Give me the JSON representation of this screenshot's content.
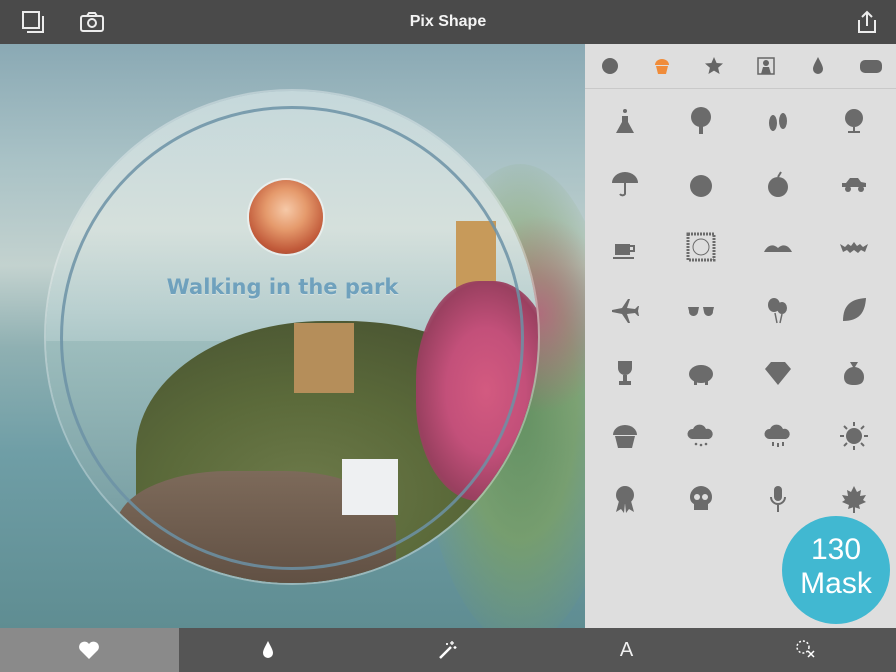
{
  "app": {
    "title": "Pix Shape"
  },
  "toolbar": {
    "left_icons": [
      "layers-icon",
      "camera-icon"
    ],
    "right_icon": "share-icon"
  },
  "canvas": {
    "caption": "Walking in the park"
  },
  "shape_tabs": [
    "circle-icon",
    "cupcake-icon",
    "star-icon",
    "silhouette-icon",
    "drop-icon",
    "cloud-shape-icon"
  ],
  "active_shape_tab": "cupcake-icon",
  "shape_grid": [
    [
      "flask-icon",
      "tree-icon",
      "footprints-icon",
      "globe-icon"
    ],
    [
      "umbrella-icon",
      "tomato-icon",
      "apple-icon",
      "car-icon"
    ],
    [
      "coffee-cup-icon",
      "lace-frame-icon",
      "mustache-icon",
      "bat-icon"
    ],
    [
      "airplane-icon",
      "sunglasses-icon",
      "balloons-icon",
      "leaf-icon"
    ],
    [
      "trophy-icon",
      "piggy-bank-icon",
      "diamond-icon",
      "money-bag-icon"
    ],
    [
      "cupcake-icon",
      "snow-cloud-icon",
      "rain-cloud-icon",
      "sun-icon"
    ],
    [
      "award-ribbon-icon",
      "skull-icon",
      "microphone-icon",
      "maple-leaf-icon"
    ]
  ],
  "mask_badge": {
    "count": "130",
    "label": "Mask"
  },
  "bottom_tabs": [
    {
      "icon": "heart-icon",
      "text": ""
    },
    {
      "icon": "drop-icon",
      "text": ""
    },
    {
      "icon": "magic-wand-icon",
      "text": ""
    },
    {
      "icon": "text-icon",
      "text": "A"
    },
    {
      "icon": "scissors-icon",
      "text": ""
    }
  ],
  "colors": {
    "top_bar": "#4a4a4a",
    "bottom_bar": "#555555",
    "active_tab_bg": "#8a8a8a",
    "icon_gray": "#6b6b6b",
    "accent_orange": "#f08c3a",
    "badge": "#41b8d1",
    "caption": "#6fa1bd"
  }
}
